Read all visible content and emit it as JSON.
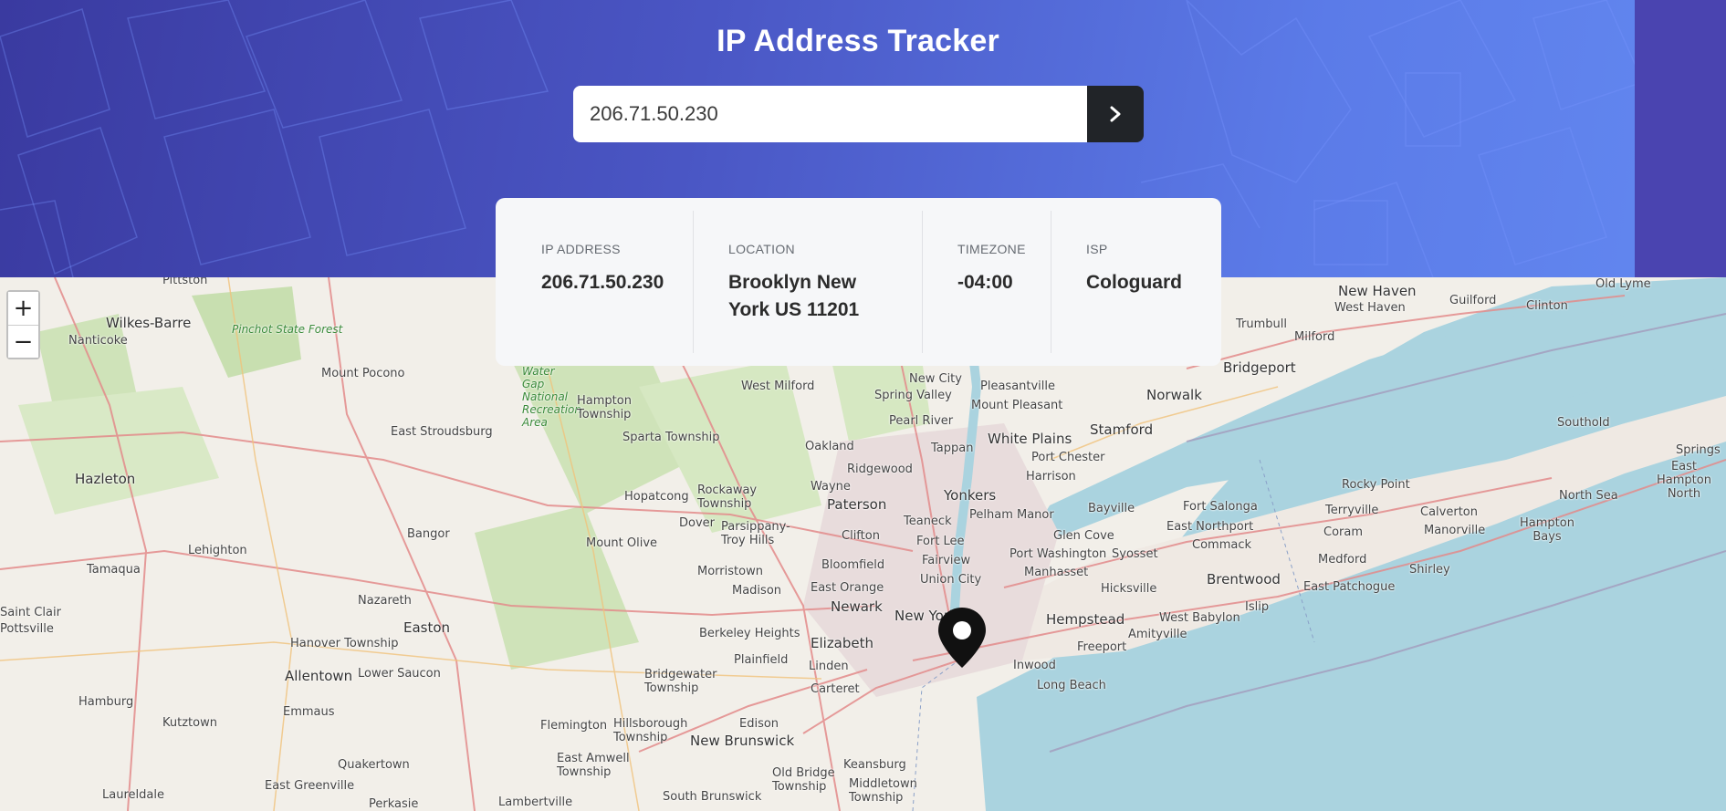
{
  "header": {
    "title": "IP Address Tracker"
  },
  "search": {
    "value": "206.71.50.230",
    "submit_icon": "chevron-right-icon"
  },
  "info": [
    {
      "label": "IP Address",
      "value": "206.71.50.230"
    },
    {
      "label": "Location",
      "value": "Brooklyn New York US 11201"
    },
    {
      "label": "Timezone",
      "value": "-04:00"
    },
    {
      "label": "ISP",
      "value": "Cologuard"
    }
  ],
  "map": {
    "zoom_in_label": "+",
    "zoom_out_label": "−",
    "marker_icon": "location-pin-icon",
    "labels": [
      "Pittston",
      "Wilkes-Barre",
      "Pinchot State Forest",
      "Nanticoke",
      "Mount Pocono",
      "East Stroudsburg",
      "Hazleton",
      "Bangor",
      "Lehighton",
      "Tamaqua",
      "Nazareth",
      "Easton",
      "Saint Clair",
      "Pottsville",
      "Hanover Township",
      "Allentown",
      "Lower Saucon",
      "Emmaus",
      "Hamburg",
      "Kutztown",
      "Quakertown",
      "East Greenville",
      "Laureldale",
      "Perkasie",
      "Lambertville",
      "Water Gap National Recreation Area",
      "Hampton Township",
      "Sparta Township",
      "Hopatcong",
      "Mount Olive",
      "Rockaway Township",
      "Dover",
      "Parsippany-Troy Hills",
      "Morristown",
      "Madison",
      "Berkeley Heights",
      "Plainfield",
      "Bridgewater Township",
      "Hillsborough Township",
      "Flemington",
      "East Amwell Township",
      "New Brunswick",
      "Edison",
      "Old Bridge Township",
      "South Brunswick",
      "Keansburg",
      "Middletown Township",
      "West Milford",
      "New City",
      "Spring Valley",
      "Pearl River",
      "Oakland",
      "Ridgewood",
      "Wayne",
      "Paterson",
      "Clifton",
      "Bloomfield",
      "East Orange",
      "Newark",
      "Elizabeth",
      "Linden",
      "Carteret",
      "Tappan",
      "Teaneck",
      "Fort Lee",
      "Fairview",
      "Union City",
      "New York",
      "Yonkers",
      "Pelham Manor",
      "Pleasantville",
      "Mount Pleasant",
      "White Plains",
      "Harrison",
      "Port Chester",
      "Stamford",
      "Norwalk",
      "Bridgeport",
      "Trumbull",
      "Milford",
      "New Haven",
      "West Haven",
      "Guilford",
      "Clinton",
      "Old Lyme",
      "Southold",
      "Springs",
      "East Hampton North",
      "North Sea",
      "Rocky Point",
      "Calverton",
      "Hampton Bays",
      "Terryville",
      "Coram",
      "Manorville",
      "Shirley",
      "Medford",
      "East Patchogue",
      "Fort Salonga",
      "East Northport",
      "Commack",
      "Bayville",
      "Glen Cove",
      "Port Washington",
      "Manhasset",
      "Syosset",
      "Hicksville",
      "Brentwood",
      "Islip",
      "West Babylon",
      "Amityville",
      "Hempstead",
      "Freeport",
      "Inwood",
      "Long Beach"
    ]
  }
}
